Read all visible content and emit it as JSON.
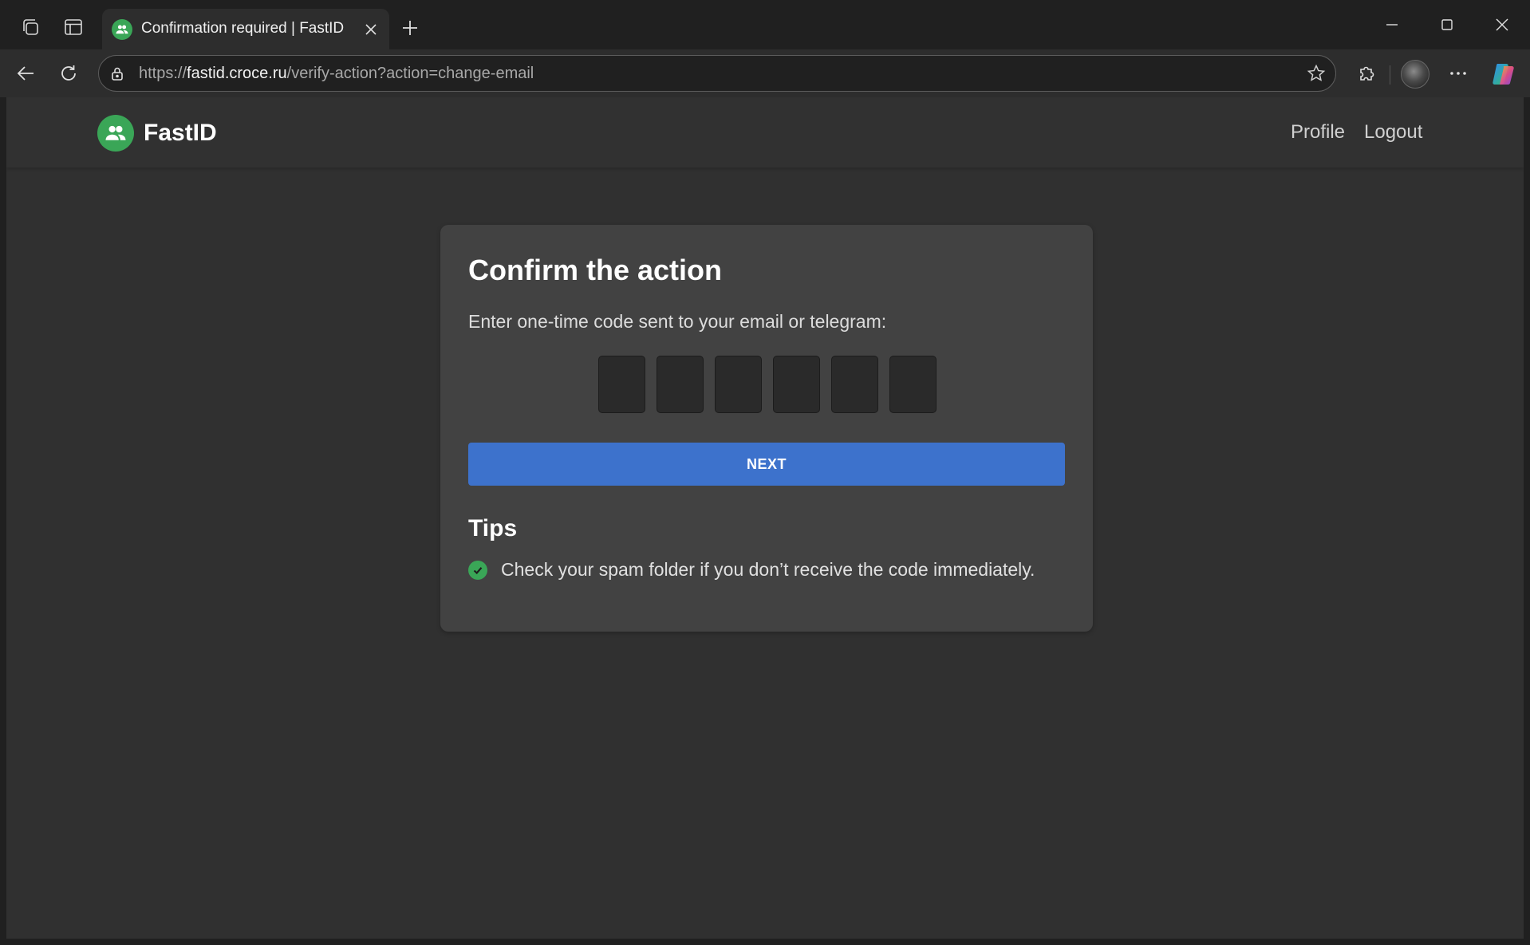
{
  "browser": {
    "tab": {
      "title": "Confirmation required | FastID"
    },
    "address_bar": {
      "scheme": "https://",
      "host": "fastid.croce.ru",
      "path": "/verify-action?action=change-email"
    },
    "icons": {
      "workspaces": "tab-workspaces-icon",
      "tab_actions": "tab-actions-icon",
      "close_tab": "close-icon",
      "new_tab": "plus-icon",
      "back": "back-arrow-icon",
      "reload": "reload-icon",
      "site_info": "lock-icon",
      "favorite": "star-icon",
      "extensions": "puzzle-icon",
      "more": "more-icon",
      "copilot": "copilot-icon",
      "minimize": "minimize-icon",
      "maximize": "maximize-icon",
      "close_window": "close-icon"
    }
  },
  "header": {
    "brand": "FastID",
    "nav": [
      {
        "label": "Profile"
      },
      {
        "label": "Logout"
      }
    ]
  },
  "card": {
    "title": "Confirm the action",
    "subtitle": "Enter one-time code sent to your email or telegram:",
    "code_digits": [
      "",
      "",
      "",
      "",
      "",
      ""
    ],
    "submit_label": "NEXT",
    "tips_title": "Tips",
    "tips": [
      {
        "text": "Check your spam folder if you don’t receive the code immediately."
      }
    ]
  },
  "colors": {
    "accent_green": "#3aa657",
    "button_blue": "#3d72cc",
    "page_background": "#303030",
    "card_background": "#424242"
  }
}
